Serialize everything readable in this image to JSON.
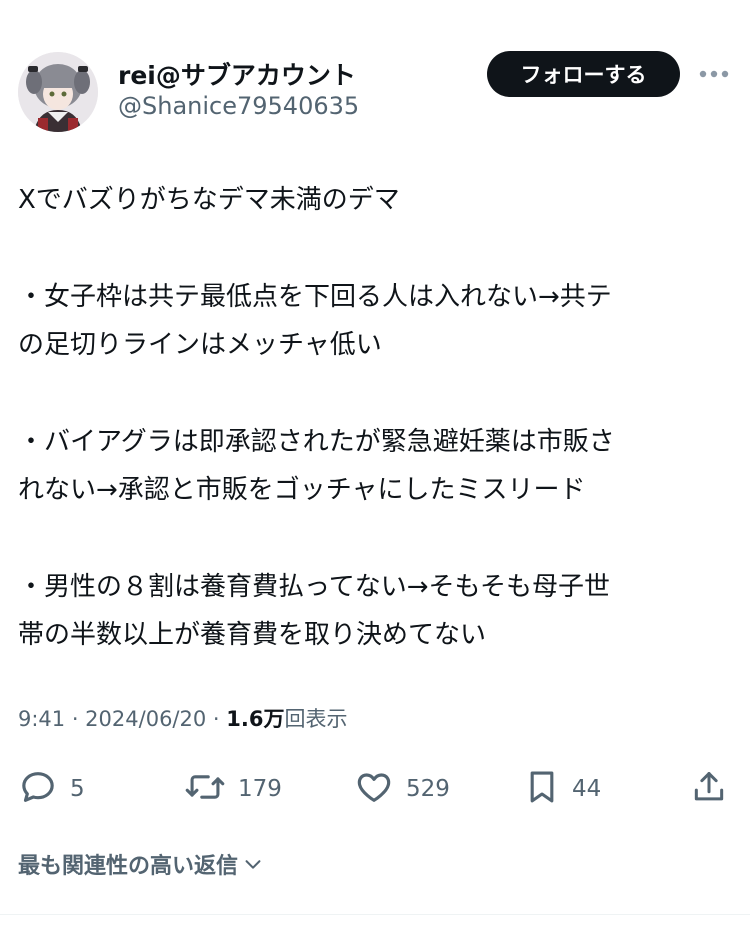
{
  "author": {
    "display_name": "rei@サブアカウント",
    "handle": "@Shanice79540635",
    "follow_label": "フォローする"
  },
  "tweet": {
    "paragraphs": [
      [
        "Xでバズりがちなデマ未満のデマ"
      ],
      [
        "・女子枠は共テ最低点を下回る人は入れない→共テ",
        "の足切りラインはメッチャ低い"
      ],
      [
        "・バイアグラは即承認されたが緊急避妊薬は市販さ",
        "れない→承認と市販をゴッチャにしたミスリード"
      ],
      [
        "・男性の８割は養育費払ってない→そもそも母子世",
        "帯の半数以上が養育費を取り決めてない"
      ]
    ]
  },
  "meta": {
    "time_date": "9:41 · 2024/06/20 · ",
    "views_count": "1.6万",
    "views_label": "回表示"
  },
  "actions": {
    "replies": "5",
    "reposts": "179",
    "likes": "529",
    "bookmarks": "44"
  },
  "replies_sort_label": "最も関連性の高い返信",
  "icons": {
    "more": "more-horizontal-icon",
    "reply": "reply-icon",
    "repost": "repost-icon",
    "like": "heart-icon",
    "bookmark": "bookmark-icon",
    "share": "share-icon",
    "chevron": "chevron-down-icon"
  },
  "colors": {
    "text_primary": "#0f1419",
    "text_secondary": "#536471",
    "follow_button_bg": "#0f1419",
    "divider": "#eff3f4"
  }
}
